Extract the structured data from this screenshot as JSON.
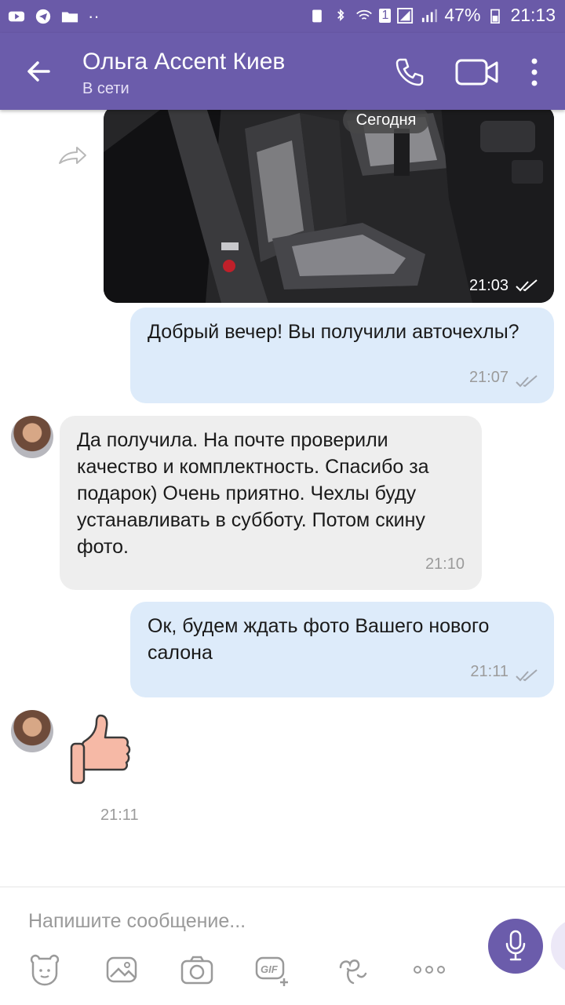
{
  "status_bar": {
    "battery": "47%",
    "time": "21:13",
    "sim": "1"
  },
  "header": {
    "contact_name": "Ольга Accent Киев",
    "contact_status": "В сети"
  },
  "chat": {
    "date_label": "Сегодня",
    "photo_message": {
      "time": "21:03"
    },
    "messages": [
      {
        "direction": "outgoing",
        "text": "Добрый вечер! Вы получили авточехлы?",
        "time": "21:07"
      },
      {
        "direction": "incoming",
        "text": "Да получила. На почте проверили качество и комплектность. Спасибо за подарок)  Очень приятно. Чехлы буду устанавливать в субботу. Потом скину фото.",
        "time": "21:10"
      },
      {
        "direction": "outgoing",
        "text": "Ок, будем ждать фото Вашего нового салона",
        "time": "21:11"
      },
      {
        "direction": "incoming",
        "sticker": "thumbs-up-icon",
        "time": "21:11"
      }
    ]
  },
  "composer": {
    "placeholder": "Напишите сообщение...",
    "tools": [
      "sticker-icon",
      "gallery-icon",
      "camera-icon",
      "gif-icon",
      "doodle-icon",
      "more-options-icon"
    ]
  },
  "colors": {
    "header": "#6b5cab",
    "outgoing_bubble": "#ddebfa",
    "incoming_bubble": "#eeeeee",
    "mic_button": "#6b5cab"
  }
}
